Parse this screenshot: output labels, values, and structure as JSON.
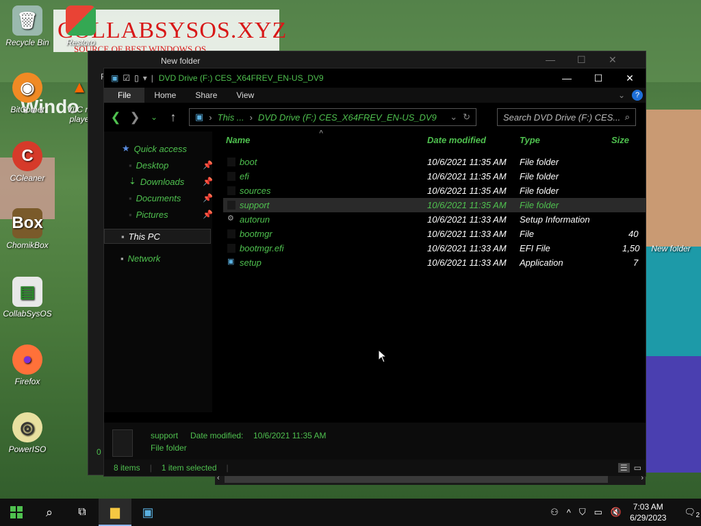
{
  "desktop": {
    "icons": [
      {
        "label": "Recycle Bin",
        "glyph": "recycle-bin-icon"
      },
      {
        "label": "Restoro",
        "glyph": "restoro-icon"
      },
      {
        "label": "BitComet",
        "glyph": "bitcomet-icon"
      },
      {
        "label": "VLC m",
        "glyph": "vlc-icon"
      },
      {
        "label": "playe",
        "glyph": "vlc-icon"
      },
      {
        "label": "CCleaner",
        "glyph": "ccleaner-icon"
      },
      {
        "label": "ChomikBox",
        "glyph": "chomikbox-icon"
      },
      {
        "label": "CollabSysOS",
        "glyph": "collabsysos-icon"
      },
      {
        "label": "Firefox",
        "glyph": "firefox-icon"
      },
      {
        "label": "PowerISO",
        "glyph": "poweriso-icon"
      },
      {
        "label": "New folder",
        "glyph": "folder-icon"
      }
    ],
    "banner": {
      "title": "COLLABSYSOS.XYZ",
      "subtitle": "SOURCE OF BEST WINDOWS OS"
    },
    "win_logo_text": "Windo"
  },
  "back_window": {
    "title": "New folder",
    "partial_left": "F",
    "partial_bottom": "0"
  },
  "window": {
    "title": "DVD Drive (F:) CES_X64FREV_EN-US_DV9",
    "ribbon_tabs": [
      "File",
      "Home",
      "Share",
      "View"
    ],
    "help_glyph": "?",
    "address": {
      "seg1": "This ...",
      "seg2": "DVD Drive (F:) CES_X64FREV_EN-US_DV9"
    },
    "search_placeholder": "Search DVD Drive (F:) CES...",
    "sidebar": {
      "quick_access": "Quick access",
      "items": [
        "Desktop",
        "Downloads",
        "Documents",
        "Pictures"
      ],
      "this_pc": "This PC",
      "network": "Network"
    },
    "columns": {
      "name": "Name",
      "date": "Date modified",
      "type": "Type",
      "size": "Size"
    },
    "files": [
      {
        "name": "boot",
        "date": "10/6/2021 11:35 AM",
        "type": "File folder",
        "size": ""
      },
      {
        "name": "efi",
        "date": "10/6/2021 11:35 AM",
        "type": "File folder",
        "size": ""
      },
      {
        "name": "sources",
        "date": "10/6/2021 11:35 AM",
        "type": "File folder",
        "size": ""
      },
      {
        "name": "support",
        "date": "10/6/2021 11:35 AM",
        "type": "File folder",
        "size": ""
      },
      {
        "name": "autorun",
        "date": "10/6/2021 11:33 AM",
        "type": "Setup Information",
        "size": ""
      },
      {
        "name": "bootmgr",
        "date": "10/6/2021 11:33 AM",
        "type": "File",
        "size": "40"
      },
      {
        "name": "bootmgr.efi",
        "date": "10/6/2021 11:33 AM",
        "type": "EFI File",
        "size": "1,50"
      },
      {
        "name": "setup",
        "date": "10/6/2021 11:33 AM",
        "type": "Application",
        "size": "7"
      }
    ],
    "details": {
      "name": "support",
      "date_label": "Date modified:",
      "date_value": "10/6/2021 11:35 AM",
      "type": "File folder"
    },
    "status": {
      "count": "8 items",
      "selected": "1 item selected"
    }
  },
  "taskbar": {
    "time": "7:03 AM",
    "date": "6/29/2023",
    "notifications": "2"
  }
}
